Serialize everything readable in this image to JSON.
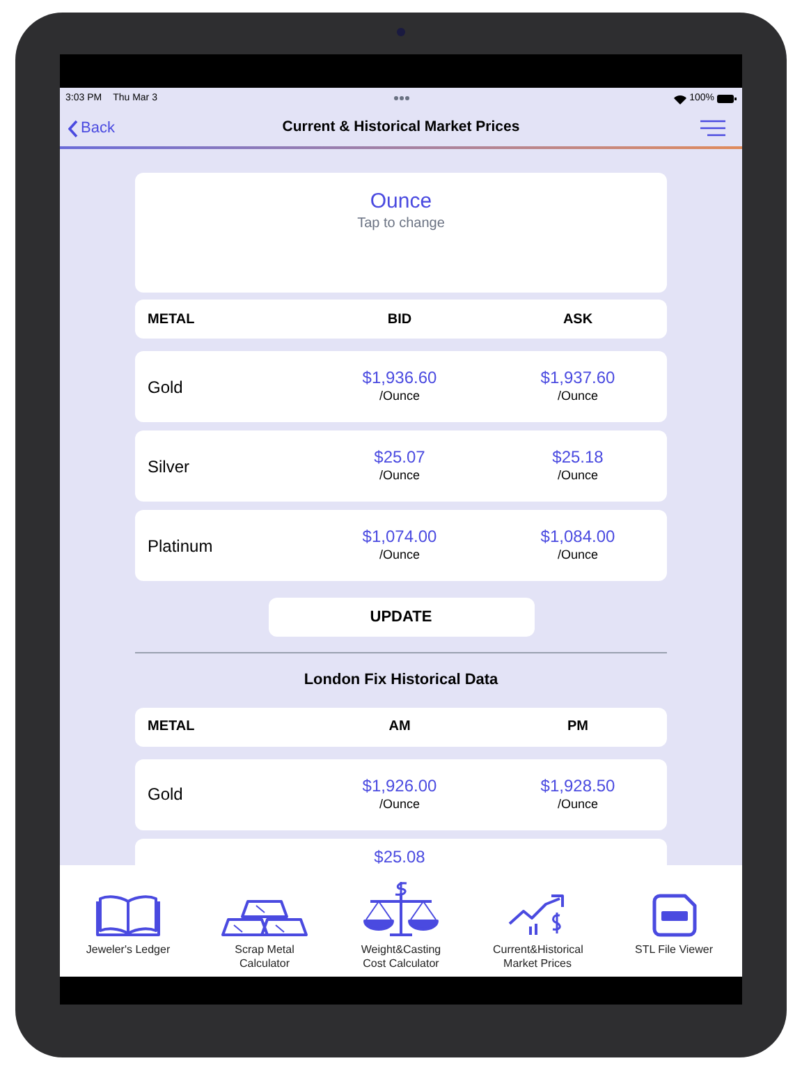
{
  "status_bar": {
    "time": "3:03 PM",
    "date": "Thu Mar 3",
    "battery": "100%"
  },
  "nav": {
    "back": "Back",
    "title": "Current & Historical Market Prices"
  },
  "unit": {
    "value": "Ounce",
    "hint": "Tap to change"
  },
  "current": {
    "columns": [
      "METAL",
      "BID",
      "ASK"
    ],
    "rows": [
      {
        "metal": "Gold",
        "bid": "$1,936.60",
        "bid_unit": "/Ounce",
        "ask": "$1,937.60",
        "ask_unit": "/Ounce"
      },
      {
        "metal": "Silver",
        "bid": "$25.07",
        "bid_unit": "/Ounce",
        "ask": "$25.18",
        "ask_unit": "/Ounce"
      },
      {
        "metal": "Platinum",
        "bid": "$1,074.00",
        "bid_unit": "/Ounce",
        "ask": "$1,084.00",
        "ask_unit": "/Ounce"
      }
    ]
  },
  "update_button": "UPDATE",
  "historical": {
    "title": "London Fix Historical Data",
    "columns": [
      "METAL",
      "AM",
      "PM"
    ],
    "rows": [
      {
        "metal": "Gold",
        "am": "$1,926.00",
        "am_unit": "/Ounce",
        "pm": "$1,928.50",
        "pm_unit": "/Ounce"
      }
    ],
    "partial_value": "$25.08"
  },
  "tabs": [
    {
      "kind": "book",
      "label": "Jeweler's Ledger"
    },
    {
      "kind": "bars",
      "label": "Scrap Metal Calculator"
    },
    {
      "kind": "scale",
      "label": "Weight&Casting Cost Calculator"
    },
    {
      "kind": "chart",
      "label": "Current&Historical Market Prices"
    },
    {
      "kind": "file",
      "label": "STL File Viewer"
    }
  ]
}
